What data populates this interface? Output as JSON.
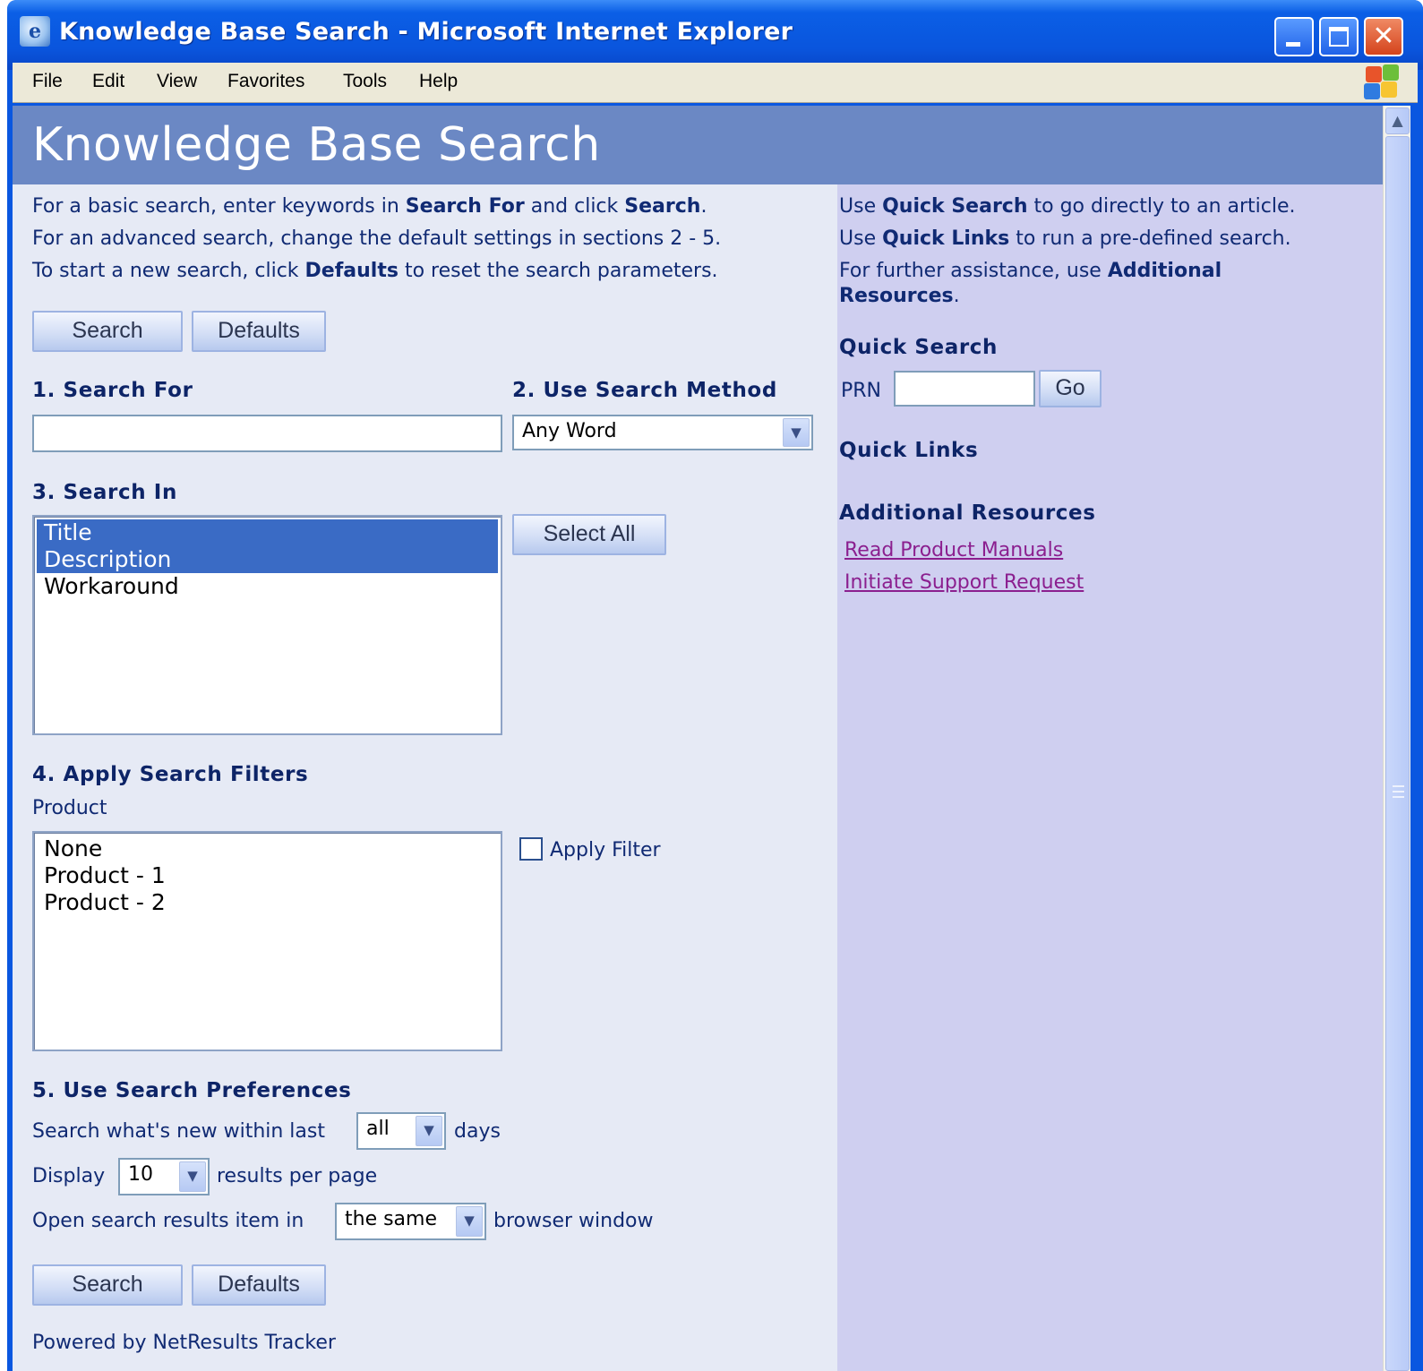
{
  "window": {
    "title": "Knowledge Base Search - Microsoft Internet Explorer",
    "menu": [
      "File",
      "Edit",
      "View",
      "Favorites",
      "Tools",
      "Help"
    ]
  },
  "page": {
    "title": "Knowledge Base Search",
    "intro": {
      "line1": {
        "a": "For a basic search, enter keywords in ",
        "b": "Search For",
        "c": " and click ",
        "d": "Search",
        "e": "."
      },
      "line2": "For an advanced search, change the default settings in sections 2 - 5.",
      "line3": {
        "a": "To start a new search, click ",
        "b": "Defaults",
        "c": " to reset the search parameters."
      }
    },
    "buttons": {
      "search": "Search",
      "defaults": "Defaults"
    },
    "sections": {
      "search_for": {
        "heading": "1. Search For",
        "value": ""
      },
      "search_method": {
        "heading": "2. Use Search Method",
        "selected": "Any Word"
      },
      "search_in": {
        "heading": "3. Search In",
        "options": [
          {
            "label": "Title",
            "selected": true
          },
          {
            "label": "Description",
            "selected": true
          },
          {
            "label": "Workaround",
            "selected": false
          }
        ],
        "select_all": "Select All"
      },
      "filters": {
        "heading": "4. Apply Search Filters",
        "product_label": "Product",
        "options": [
          "None",
          "Product - 1",
          "Product - 2"
        ],
        "apply_filter": "Apply Filter",
        "apply_filter_checked": false
      },
      "preferences": {
        "heading": "5. Use Search Preferences",
        "row1": {
          "before": "Search what's new within last",
          "selected": "all",
          "after": "days"
        },
        "row2": {
          "before": "Display",
          "selected": "10",
          "after": "results per page"
        },
        "row3": {
          "before": "Open search results item in",
          "selected": "the same",
          "after": "browser window"
        }
      }
    },
    "footer": "Powered by NetResults Tracker"
  },
  "sidebar": {
    "help": {
      "line1": {
        "a": "Use ",
        "b": "Quick Search",
        "c": " to go directly to an article."
      },
      "line2": {
        "a": "Use ",
        "b": "Quick Links",
        "c": " to run a pre-defined search."
      },
      "line3": {
        "a": "For further assistance, use ",
        "b": "Additional"
      },
      "line4": {
        "b": "Resources",
        "c": "."
      }
    },
    "quick_search": {
      "heading": "Quick Search",
      "label": "PRN",
      "value": "",
      "go": "Go"
    },
    "quick_links": {
      "heading": "Quick Links"
    },
    "additional": {
      "heading": "Additional Resources",
      "links": [
        "Read Product Manuals",
        "Initiate Support Request"
      ]
    }
  },
  "colors": {
    "header_band": "#6b88c4",
    "left_bg": "#e6eaf5",
    "right_bg": "#cfcff0",
    "heading_text": "#0d2467",
    "link": "#8b1f8f",
    "selection": "#3a6bc5"
  }
}
